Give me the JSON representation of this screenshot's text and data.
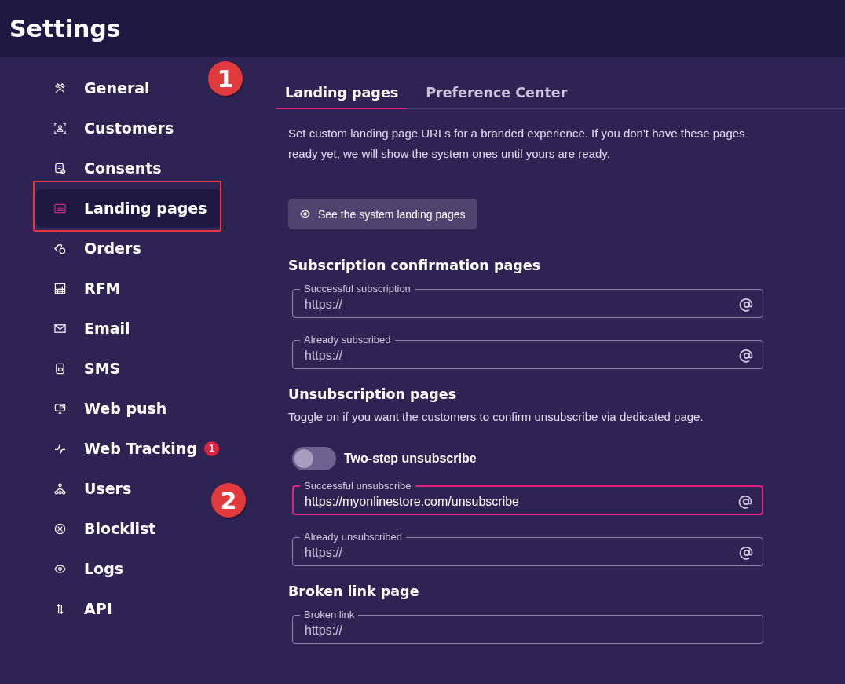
{
  "header": {
    "title": "Settings"
  },
  "sidebar": {
    "items": [
      {
        "label": "General",
        "selected": false,
        "highlighted": false
      },
      {
        "label": "Customers",
        "selected": false,
        "highlighted": false
      },
      {
        "label": "Consents",
        "selected": false,
        "highlighted": false
      },
      {
        "label": "Landing pages",
        "selected": true,
        "highlighted": true
      },
      {
        "label": "Orders",
        "selected": false,
        "highlighted": false
      },
      {
        "label": "RFM",
        "selected": false,
        "highlighted": false
      },
      {
        "label": "Email",
        "selected": false,
        "highlighted": false
      },
      {
        "label": "SMS",
        "selected": false,
        "highlighted": false
      },
      {
        "label": "Web push",
        "selected": false,
        "highlighted": false
      },
      {
        "label": "Web Tracking",
        "selected": false,
        "highlighted": false,
        "badge": "1"
      },
      {
        "label": "Users",
        "selected": false,
        "highlighted": false
      },
      {
        "label": "Blocklist",
        "selected": false,
        "highlighted": false
      },
      {
        "label": "Logs",
        "selected": false,
        "highlighted": false
      },
      {
        "label": "API",
        "selected": false,
        "highlighted": false
      }
    ]
  },
  "tabs": [
    {
      "label": "Landing pages",
      "selected": true
    },
    {
      "label": "Preference Center",
      "selected": false
    }
  ],
  "tabs_callout": "1",
  "intro": "Set custom landing page URLs for a branded experience. If you don't have these pages ready yet, we will show the system ones until yours are ready.",
  "button": {
    "label": "See the system landing pages"
  },
  "sections": [
    {
      "title": "Subscription confirmation pages",
      "fields": [
        {
          "label": "Successful subscription",
          "placeholder": "https://",
          "focused": false
        },
        {
          "label": "Already subscribed",
          "placeholder": "https://",
          "focused": false
        }
      ]
    },
    {
      "title": "Unsubscription pages",
      "description": "Toggle on if you want the customers to confirm unsubscribe via dedicated page.",
      "toggle": {
        "label": "Two-step unsubscribe",
        "on": false
      },
      "fields": [
        {
          "label": "Successful unsubscribe",
          "value": "https://myonlinestore.com/unsubscribe",
          "focused": true,
          "callout": "2"
        },
        {
          "label": "Already unsubscribed",
          "placeholder": "https://",
          "focused": false
        }
      ]
    },
    {
      "title": "Broken link page",
      "fields": [
        {
          "label": "Broken link",
          "placeholder": "https://",
          "focused": false
        }
      ]
    }
  ]
}
